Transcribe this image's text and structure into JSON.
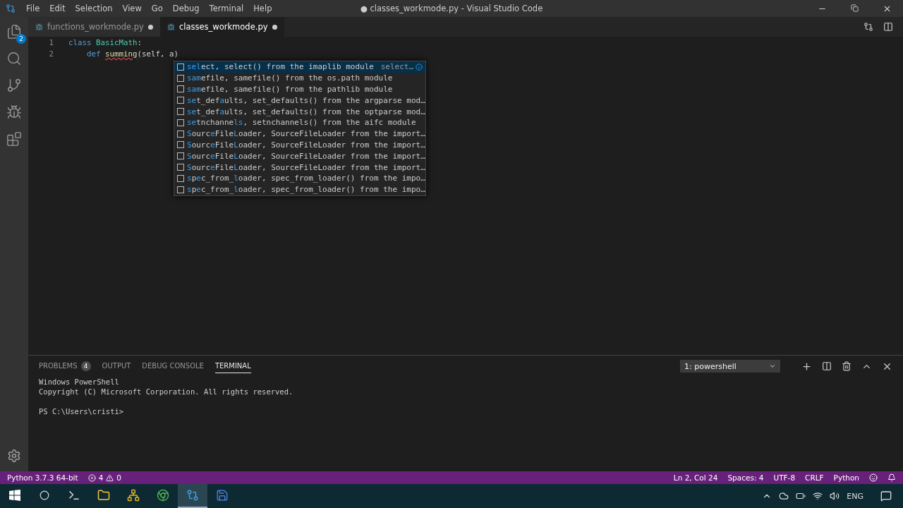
{
  "window": {
    "title": "● classes_workmode.py - Visual Studio Code"
  },
  "menu": [
    "File",
    "Edit",
    "Selection",
    "View",
    "Go",
    "Debug",
    "Terminal",
    "Help"
  ],
  "activity_bar": [
    {
      "kind": "files",
      "badge": "2",
      "selected": false
    },
    {
      "kind": "search",
      "selected": false
    },
    {
      "kind": "git",
      "selected": false
    },
    {
      "kind": "debug",
      "selected": false
    },
    {
      "kind": "extensions",
      "selected": false
    }
  ],
  "tabs": [
    {
      "label": "functions_workmode.py",
      "selected": false,
      "dirty": true
    },
    {
      "label": "classes_workmode.py",
      "selected": true,
      "dirty": true
    }
  ],
  "editor": {
    "lines": [
      {
        "number": "1",
        "indented": false,
        "tokens": [
          {
            "kind": "keyword",
            "text": "class "
          },
          {
            "kind": "type",
            "text": "BasicMath"
          },
          {
            "kind": "plain",
            "text": ":"
          }
        ]
      },
      {
        "number": "2",
        "indented": true,
        "tokens": [
          {
            "kind": "keyword",
            "text": "def "
          },
          {
            "kind": "error",
            "text": "summing"
          },
          {
            "kind": "plain",
            "text": "(self, a)"
          }
        ]
      }
    ]
  },
  "suggestions": [
    {
      "label": "**sel**ect,",
      "detail": "select() from the imaplib module",
      "info": "select…",
      "selected": true
    },
    {
      "label": "**sam**efile,",
      "detail": "samefile() from the os.path module",
      "selected": false
    },
    {
      "label": "**sam**efile,",
      "detail": "samefile() from the pathlib module",
      "selected": false
    },
    {
      "label": "**se**t_def**a**ults,",
      "detail": "set_defaults() from the argparse mod…",
      "selected": false
    },
    {
      "label": "**se**t_def**a**ults,",
      "detail": "set_defaults() from the optparse mod…",
      "selected": false
    },
    {
      "label": "**se**tnchanne**ls**,",
      "detail": "setnchannels() from the aifc module",
      "selected": false
    },
    {
      "label": "**S**ourc**e**File**L**oader,",
      "detail": "SourceFileLoader from the import…",
      "selected": false
    },
    {
      "label": "**S**ourc**e**File**L**oader,",
      "detail": "SourceFileLoader from the import…",
      "selected": false
    },
    {
      "label": "**S**ourc**e**File**L**oader,",
      "detail": "SourceFileLoader from the import…",
      "selected": false
    },
    {
      "label": "**S**ourc**e**File**L**oader,",
      "detail": "SourceFileLoader from the import…",
      "selected": false
    },
    {
      "label": "**s**p**e**c_from_**l**oader,",
      "detail": "spec_from_loader() from the impo…",
      "selected": false
    },
    {
      "label": "**s**p**e**c_from_**l**oader,",
      "detail": "spec_from_loader() from the impo…",
      "selected": false
    }
  ],
  "panel": {
    "tabs": [
      {
        "label": "PROBLEMS",
        "badge": "4",
        "selected": false
      },
      {
        "label": "OUTPUT",
        "selected": false
      },
      {
        "label": "DEBUG CONSOLE",
        "selected": false
      },
      {
        "label": "TERMINAL",
        "selected": true
      }
    ],
    "terminal_select": "1: powershell",
    "terminal_lines": [
      "Windows PowerShell",
      "Copyright (C) Microsoft Corporation. All rights reserved."
    ],
    "prompt": "PS C:\\Users\\cristi>"
  },
  "status_bar": {
    "left": [
      {
        "kind": "text",
        "text": "Python 3.7.3 64-bit"
      },
      {
        "kind": "problems",
        "errors": "4",
        "warnings": "0"
      }
    ],
    "right": [
      "Ln 2, Col 24",
      "Spaces: 4",
      "UTF-8",
      "CRLF",
      "Python"
    ]
  },
  "taskbar": {
    "apps": [
      {
        "kind": "terminal",
        "selected": false
      },
      {
        "kind": "folder",
        "selected": false
      },
      {
        "kind": "network",
        "selected": false
      },
      {
        "kind": "browser",
        "selected": false
      },
      {
        "kind": "vscode",
        "selected": true
      },
      {
        "kind": "save",
        "selected": false
      }
    ],
    "language": "ENG"
  }
}
